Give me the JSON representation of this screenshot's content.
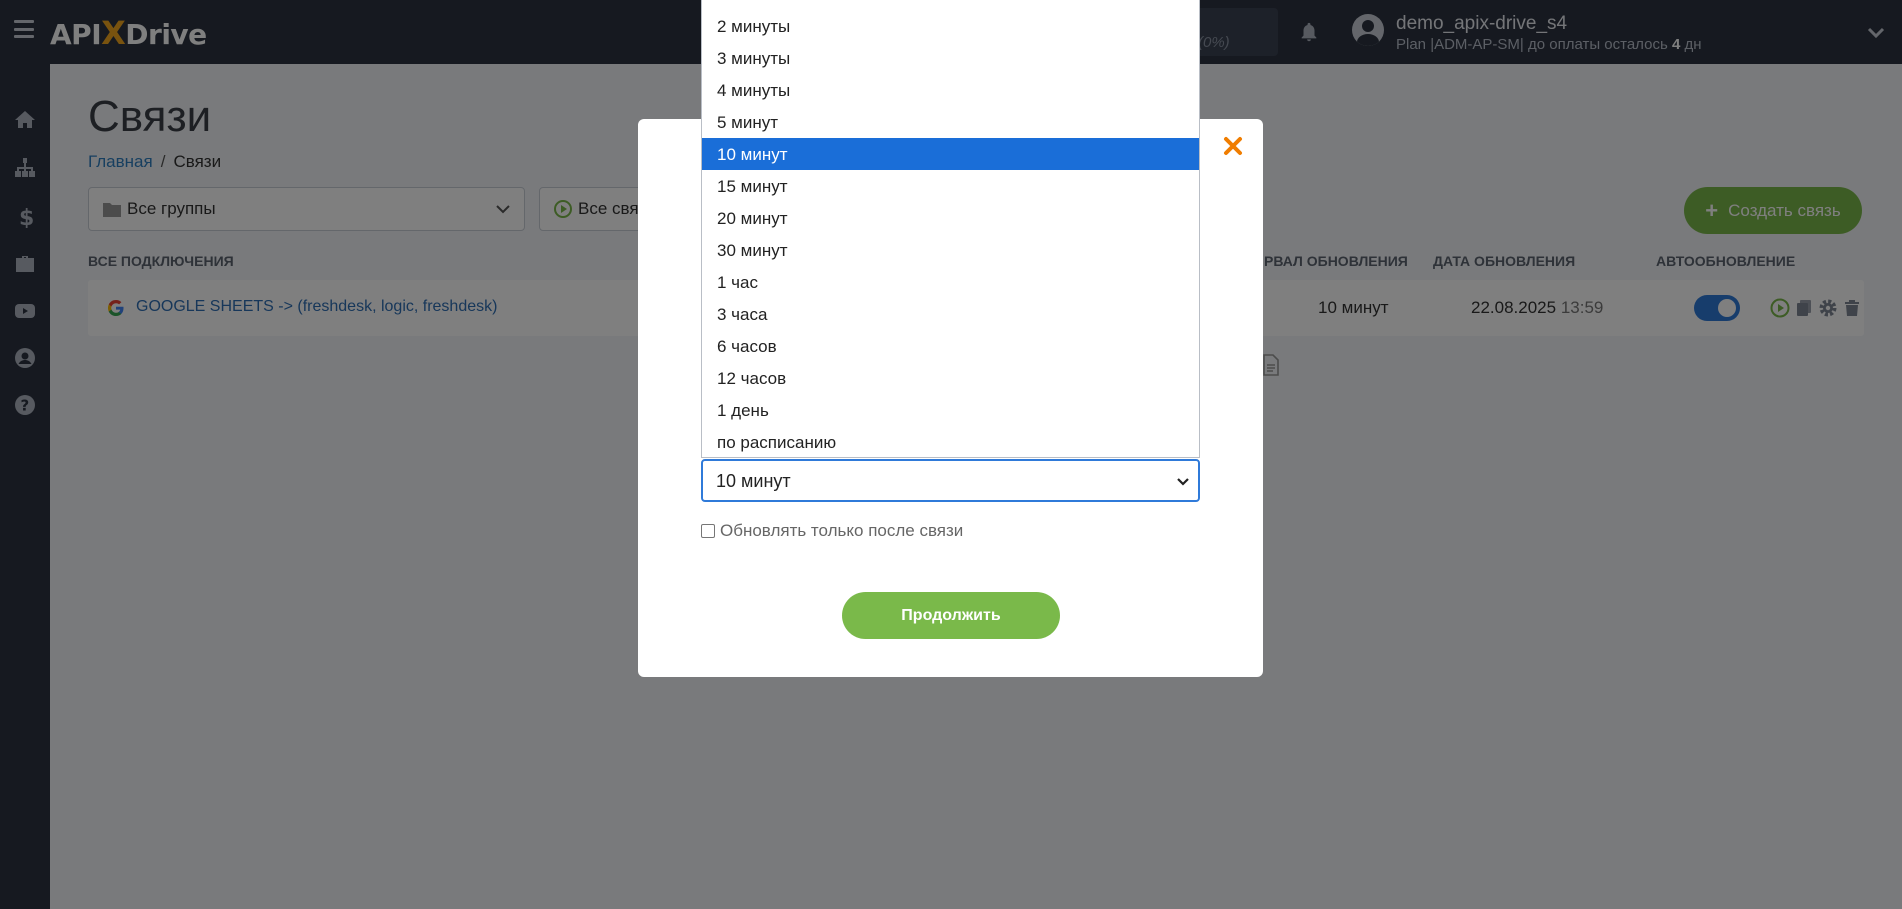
{
  "topbar": {
    "logo_left": "API",
    "logo_x": "X",
    "logo_right": "Drive",
    "usage_text": "(0%)",
    "username": "demo_apix-drive_s4",
    "plan_prefix": "Plan |ADM-AP-SM| до оплаты осталось",
    "plan_days": "4",
    "plan_suffix": "дн"
  },
  "page": {
    "title": "Связи",
    "breadcrumb_home": "Главная",
    "breadcrumb_sep": "/",
    "breadcrumb_current": "Связи"
  },
  "filters": {
    "groups_label": "Все группы",
    "status_label": "Все связ"
  },
  "create_button": {
    "plus": "+",
    "label": "Создать связь"
  },
  "table": {
    "headers": {
      "all_connections": "ВСЕ ПОДКЛЮЧЕНИЯ",
      "interval": "РВАЛ ОБНОВЛЕНИЯ",
      "date": "ДАТА ОБНОВЛЕНИЯ",
      "auto": "АВТООБНОВЛЕНИЕ"
    },
    "rows": [
      {
        "name": "GOOGLE SHEETS -> (freshdesk, logic, freshdesk)",
        "interval": "10 минут",
        "date": "22.08.2025",
        "time": "13:59",
        "auto_update": true
      }
    ]
  },
  "modal": {
    "selected_value": "10 минут",
    "checkbox_label": "Обновлять только после связи",
    "continue_label": "Продолжить",
    "options": [
      {
        "label": "2 минуты",
        "selected": false
      },
      {
        "label": "3 минуты",
        "selected": false
      },
      {
        "label": "4 минуты",
        "selected": false
      },
      {
        "label": "5 минут",
        "selected": false
      },
      {
        "label": "10 минут",
        "selected": true
      },
      {
        "label": "15 минут",
        "selected": false
      },
      {
        "label": "20 минут",
        "selected": false
      },
      {
        "label": "30 минут",
        "selected": false
      },
      {
        "label": "1 час",
        "selected": false
      },
      {
        "label": "3 часа",
        "selected": false
      },
      {
        "label": "6 часов",
        "selected": false
      },
      {
        "label": "12 часов",
        "selected": false
      },
      {
        "label": "1 день",
        "selected": false
      },
      {
        "label": "по расписанию",
        "selected": false
      }
    ]
  },
  "colors": {
    "topbar_bg": "#2c3340",
    "accent_green": "#7ab94a",
    "accent_blue": "#2f7ad9",
    "selected_option": "#1a6ed8",
    "close_orange": "#f07d00"
  }
}
